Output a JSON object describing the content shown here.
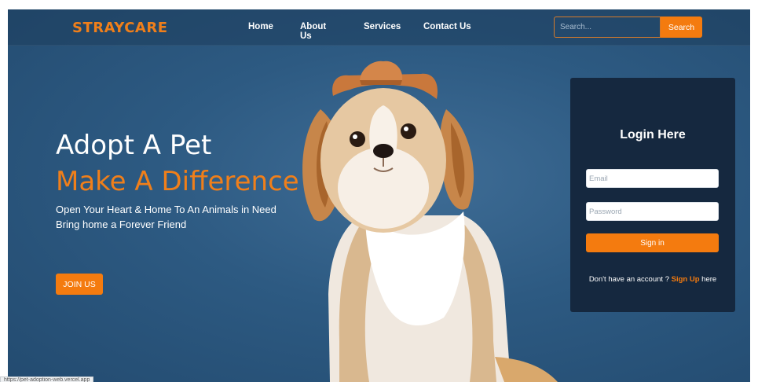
{
  "nav": {
    "brand": "STRAYCARE",
    "links": [
      "Home",
      "About Us",
      "Services",
      "Contact Us"
    ],
    "search_placeholder": "Search...",
    "search_button": "Search"
  },
  "hero": {
    "title": "Adopt A Pet",
    "subtitle": "Make A Difference",
    "line1": "Open Your Heart & Home To An Animals in Need",
    "line2": "Bring home a Forever Friend",
    "join_button": "JOIN US"
  },
  "login": {
    "title": "Login Here",
    "email_placeholder": "Email",
    "password_placeholder": "Password",
    "signin_button": "Sign in",
    "signup_prefix": "Don't have an account ? ",
    "signup_link": "Sign Up",
    "signup_suffix": " here"
  },
  "status_bar": {
    "url": "https://pet-adoption-web.vercel.app"
  },
  "colors": {
    "accent": "#f47b0f",
    "background": "#2d5a82",
    "card": "#15283f"
  },
  "icons": {
    "dog_image": "dog-photo"
  }
}
